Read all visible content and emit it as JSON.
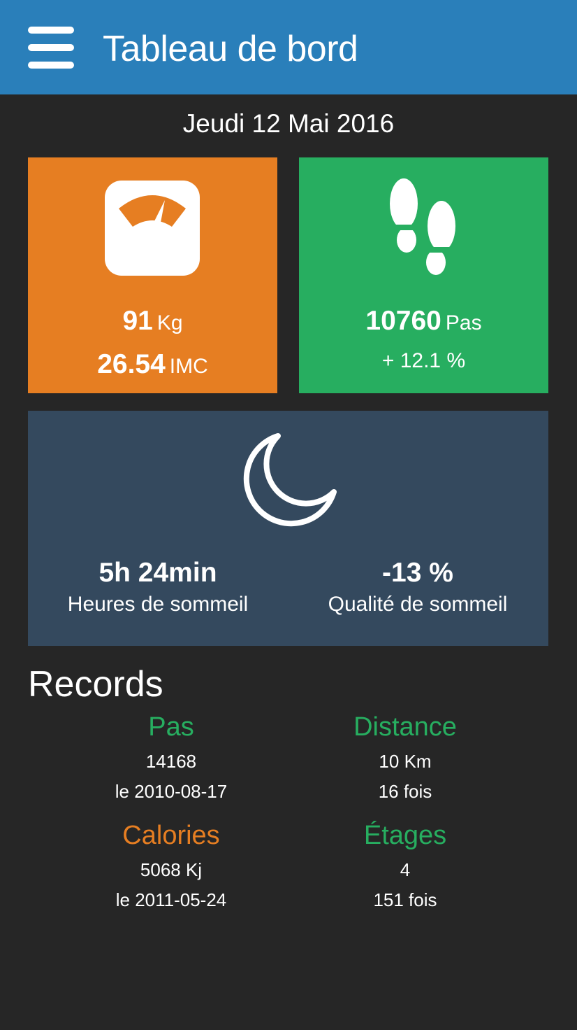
{
  "appbar": {
    "title": "Tableau de bord"
  },
  "date": "Jeudi 12 Mai 2016",
  "weight": {
    "value": "91",
    "unit": "Kg",
    "bmi": "26.54",
    "bmi_unit": "IMC"
  },
  "steps": {
    "value": "10760",
    "unit": "Pas",
    "change": "+ 12.1 %"
  },
  "sleep": {
    "duration": "5h 24min",
    "duration_label": "Heures de sommeil",
    "quality": "-13 %",
    "quality_label": "Qualité de sommeil"
  },
  "records": {
    "title": "Records",
    "items": [
      {
        "title": "Pas",
        "line1": "14168",
        "line2": "le 2010-08-17"
      },
      {
        "title": "Distance",
        "line1": "10 Km",
        "line2": "16 fois"
      },
      {
        "title": "Calories",
        "line1": "5068 Kj",
        "line2": "le 2011-05-24"
      },
      {
        "title": "Étages",
        "line1": "4",
        "line2": "151 fois"
      }
    ]
  },
  "colors": {
    "appbar": "#2a7fba",
    "background": "#262626",
    "weight_tile": "#e67e22",
    "steps_tile": "#27ae60",
    "sleep_tile": "#34495e"
  },
  "icons": [
    "menu-icon",
    "scale-icon",
    "footprints-icon",
    "moon-icon"
  ]
}
